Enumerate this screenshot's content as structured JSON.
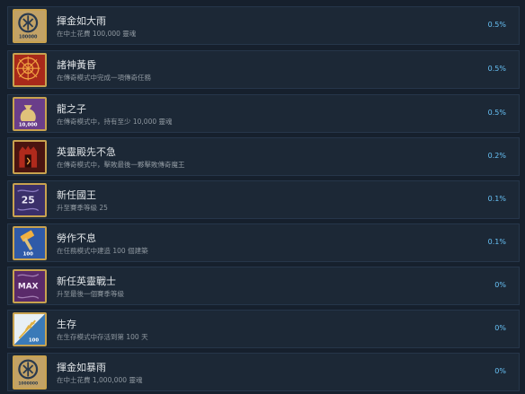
{
  "achievements": [
    {
      "title": "揮金如大雨",
      "desc": "在中土花費 100,000 靈魂",
      "percent": "0.5%",
      "icon": "rune-coin-icon",
      "badge_text": "100000"
    },
    {
      "title": "諸神黃昏",
      "desc": "在傳奇模式中完成一項傳奇任務",
      "percent": "0.5%",
      "icon": "red-sun-rune-icon",
      "badge_text": ""
    },
    {
      "title": "龍之子",
      "desc": "在傳奇模式中，持有至少 10,000 靈魂",
      "percent": "0.5%",
      "icon": "money-bag-icon",
      "badge_text": "10,000"
    },
    {
      "title": "英靈殿先不急",
      "desc": "在傳奇模式中，擊敗最後一夥擊敗傳奇魔王",
      "percent": "0.2%",
      "icon": "red-gate-icon",
      "badge_text": ""
    },
    {
      "title": "新任國王",
      "desc": "升至賽季等級 25",
      "percent": "0.1%",
      "icon": "level-25-icon",
      "badge_text": "25"
    },
    {
      "title": "勞作不息",
      "desc": "在任務模式中建造 100 個建築",
      "percent": "0.1%",
      "icon": "hammer-icon",
      "badge_text": "100"
    },
    {
      "title": "新任英靈戰士",
      "desc": "升至最後一個賽季等級",
      "percent": "0%",
      "icon": "max-level-icon",
      "badge_text": "MAX"
    },
    {
      "title": "生存",
      "desc": "在生存模式中存活到第 100 天",
      "percent": "0%",
      "icon": "wheat-icon",
      "badge_text": "100"
    },
    {
      "title": "揮金如暴雨",
      "desc": "在中土花費 1,000,000 靈魂",
      "percent": "0%",
      "icon": "rune-coin-icon",
      "badge_text": "1000000"
    }
  ]
}
